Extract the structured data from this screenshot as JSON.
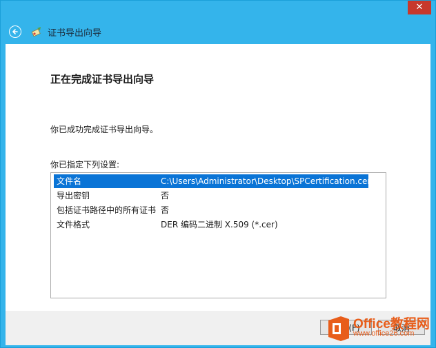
{
  "window": {
    "close_glyph": "✕"
  },
  "header": {
    "title": "证书导出向导"
  },
  "main": {
    "title": "正在完成证书导出向导",
    "success_text": "你已成功完成证书导出向导。",
    "settings_label": "你已指定下列设置:",
    "settings": [
      {
        "key": "文件名",
        "value": "C:\\Users\\Administrator\\Desktop\\SPCertification.cer",
        "selected": true
      },
      {
        "key": "导出密钥",
        "value": "否",
        "selected": false
      },
      {
        "key": "包括证书路径中的所有证书",
        "value": "否",
        "selected": false
      },
      {
        "key": "文件格式",
        "value": "DER 编码二进制 X.509 (*.cer)",
        "selected": false
      }
    ]
  },
  "footer": {
    "finish_label": "完成(F)",
    "cancel_label": "取消"
  },
  "watermark": {
    "line1": "Office教程网",
    "line2": "www.office26.com"
  },
  "colors": {
    "chrome_blue": "#34b4eb",
    "selection_blue": "#0a74d6",
    "close_red": "#c7382c",
    "watermark_orange": "#e85d1a"
  }
}
